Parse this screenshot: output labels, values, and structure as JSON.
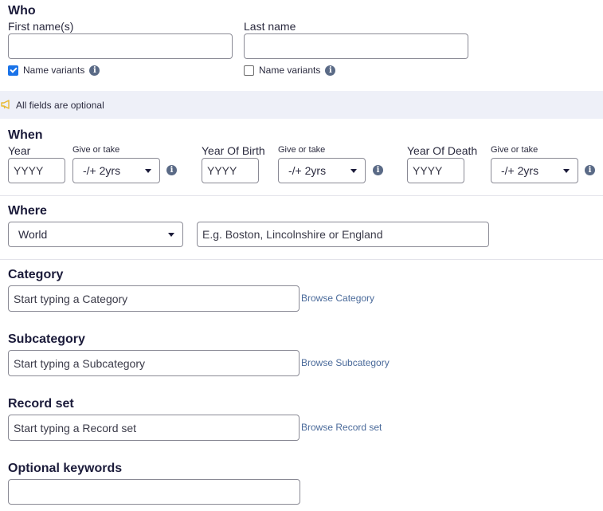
{
  "who": {
    "title": "Who",
    "first_name_label": "First name(s)",
    "first_name_value": "",
    "last_name_label": "Last name",
    "last_name_value": "",
    "first_variants_label": "Name variants",
    "first_variants_checked": true,
    "last_variants_label": "Name variants",
    "last_variants_checked": false,
    "info_glyph": "i"
  },
  "banner": {
    "icon": "megaphone-icon",
    "text": "All fields are optional"
  },
  "when": {
    "title": "When",
    "give_or_take_label": "Give or take",
    "year": {
      "label": "Year",
      "placeholder": "YYYY",
      "range": "-/+ 2yrs"
    },
    "birth": {
      "label": "Year Of Birth",
      "placeholder": "YYYY",
      "range": "-/+ 2yrs"
    },
    "death": {
      "label": "Year Of Death",
      "placeholder": "YYYY",
      "range": "-/+ 2yrs"
    }
  },
  "where": {
    "title": "Where",
    "region": "World",
    "place_placeholder": "E.g. Boston, Lincolnshire or England"
  },
  "category": {
    "title": "Category",
    "placeholder": "Start typing a Category",
    "browse": "Browse Category"
  },
  "subcategory": {
    "title": "Subcategory",
    "placeholder": "Start typing a Subcategory",
    "browse": "Browse Subcategory"
  },
  "record_set": {
    "title": "Record set",
    "placeholder": "Start typing a Record set",
    "browse": "Browse Record set"
  },
  "keywords": {
    "title": "Optional keywords",
    "value": ""
  },
  "colors": {
    "accent": "#1a73e8",
    "link": "#4a6a9a",
    "banner_bg": "#eef0f8",
    "heading": "#1b1b3a"
  }
}
